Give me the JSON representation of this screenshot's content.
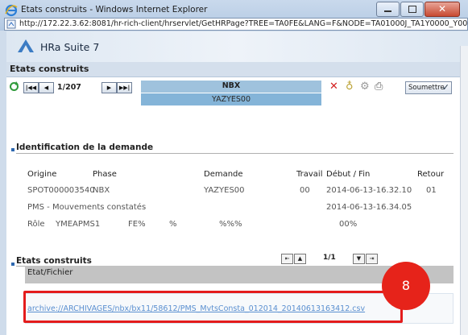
{
  "window": {
    "title": "Etats construits - Windows Internet Explorer",
    "address": "http://172.22.3.62:8081/hr-rich-client/hrservlet/GetHRPage?TREE=TA0FE&LANG=F&NODE=TA01000J_TA1Y0000_Y00"
  },
  "app": {
    "brand": "HRa Suite 7",
    "page_title": "Etats construits"
  },
  "toolbar": {
    "first": "|◀◀",
    "prev": "◀",
    "pager": "1/207",
    "next": "▶",
    "last": "▶▶|",
    "phase_code": "NBX",
    "demand_code": "YAZYES00",
    "submit_label": "Soumettre",
    "submit_arrow": "✓"
  },
  "identification": {
    "title": "Identification de la demande",
    "headers": {
      "origine": "Origine",
      "phase": "Phase",
      "demande": "Demande",
      "travail": "Travail",
      "debut_fin": "Début / Fin",
      "retour": "Retour"
    },
    "row1": {
      "origine": "SPOT000003540",
      "phase": "NBX",
      "demande": "YAZYES00",
      "travail": "00",
      "debut": "2014-06-13-16.32.10",
      "retour": "01"
    },
    "row2": {
      "label": "PMS - Mouvements constatés",
      "fin": "2014-06-13-16.34.05"
    },
    "row3": {
      "role_label": "Rôle",
      "role_value": "YMEAPMS1",
      "c1": "FE%",
      "c2": "%",
      "c3": "%%%",
      "c4": "00%"
    }
  },
  "etats": {
    "title": "Etats construits",
    "pager": "1/1",
    "column_header": "Etat/Fichier",
    "file_link": "archive://ARCHIVAGES/nbx/bx11/58612/PMS_MvtsConsta_012014_20140613163412.csv"
  },
  "annotation": {
    "badge": "8",
    "colors": {
      "highlight": "#e41c1c",
      "badge": "#e6231a",
      "link": "#5a8fd0"
    }
  }
}
